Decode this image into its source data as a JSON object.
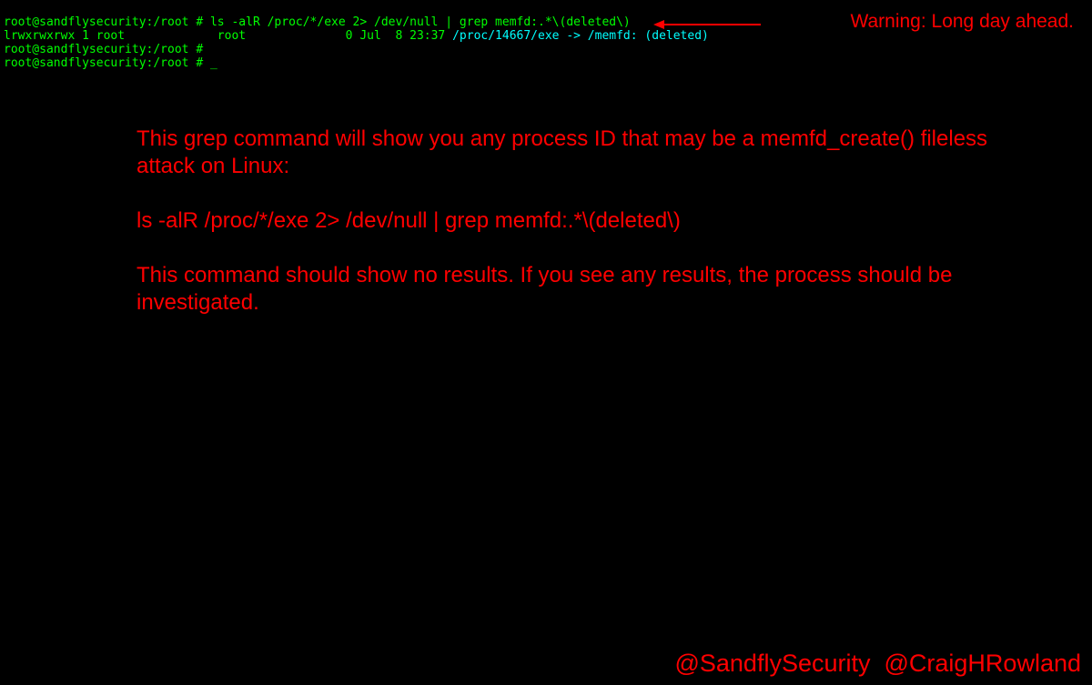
{
  "terminal": {
    "prompt": "root@sandflysecurity:/root #",
    "line1_cmd": " ls -alR /proc/*/exe 2> /dev/null | grep memfd:.*\\(deleted\\)",
    "line2_perms": "lrwxrwxrwx 1 root             root              0 Jul  8 23:37 ",
    "line2_link": "/proc/14667/exe -> /memfd: (deleted)",
    "line3_cmd": "",
    "line4_cmd": " ",
    "cursor": "_"
  },
  "annotation": {
    "warning": "Warning: Long day ahead.",
    "p1": "This grep command will show you any process ID that may be a memfd_create() fileless attack on Linux:",
    "p2": "ls -alR /proc/*/exe 2> /dev/null | grep memfd:.*\\(deleted\\)",
    "p3": "This command should show no results. If you see any results, the process should be investigated."
  },
  "credits": {
    "handle1": "@SandflySecurity",
    "handle2": "@CraigHRowland"
  }
}
